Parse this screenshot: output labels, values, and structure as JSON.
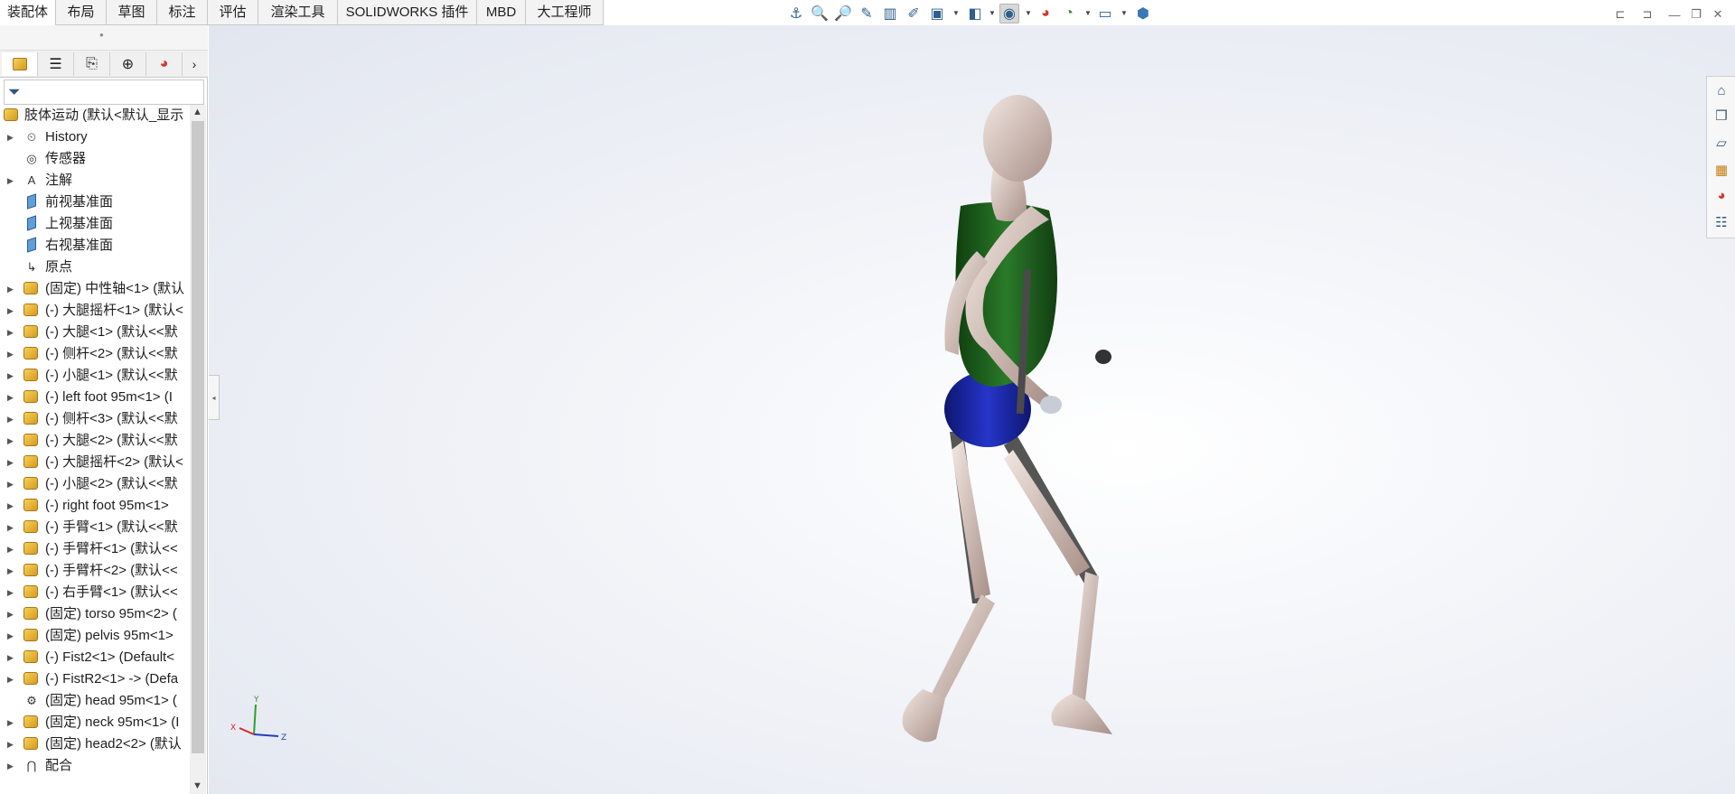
{
  "top_tabs": [
    {
      "label": "装配体",
      "active": true
    },
    {
      "label": "布局",
      "active": false
    },
    {
      "label": "草图",
      "active": false
    },
    {
      "label": "标注",
      "active": false
    },
    {
      "label": "评估",
      "active": false
    },
    {
      "label": "渲染工具",
      "active": false
    },
    {
      "label": "SOLIDWORKS 插件",
      "active": false
    },
    {
      "label": "MBD",
      "active": false
    },
    {
      "label": "大工程师",
      "active": false
    }
  ],
  "heads_up_toolbar": {
    "icons": [
      "view-orientation-icon",
      "zoom-to-fit-icon",
      "zoom-to-area-icon",
      "previous-view-icon",
      "section-view-icon",
      "dynamic-annotation-icon",
      "view-orientation-cube-icon",
      "display-style-icon",
      "hide-show-items-icon",
      "edit-appearance-icon",
      "apply-scene-icon",
      "view-settings-icon",
      "display-pane-icon"
    ]
  },
  "panel_tabs": [
    "featuremanager-icon",
    "propertymanager-icon",
    "configurationmanager-icon",
    "dimxpert-icon",
    "displaymanager-icon"
  ],
  "tree": {
    "root": "肢体运动 (默认<默认_显示",
    "items": [
      {
        "label": "History",
        "icon": "history-icon",
        "expander": true
      },
      {
        "label": "传感器",
        "icon": "sensor-icon",
        "expander": false
      },
      {
        "label": "注解",
        "icon": "annotation-icon",
        "expander": true
      },
      {
        "label": "前视基准面",
        "icon": "plane-icon",
        "expander": false
      },
      {
        "label": "上视基准面",
        "icon": "plane-icon",
        "expander": false
      },
      {
        "label": "右视基准面",
        "icon": "plane-icon",
        "expander": false
      },
      {
        "label": "原点",
        "icon": "origin-icon",
        "expander": false
      },
      {
        "label": "(固定) 中性轴<1> (默认",
        "icon": "part-icon",
        "expander": true
      },
      {
        "label": "(-) 大腿摇杆<1> (默认<",
        "icon": "part-icon",
        "expander": true
      },
      {
        "label": "(-) 大腿<1> (默认<<默",
        "icon": "part-icon",
        "expander": true
      },
      {
        "label": "(-) 侧杆<2> (默认<<默",
        "icon": "part-icon",
        "expander": true
      },
      {
        "label": "(-) 小腿<1> (默认<<默",
        "icon": "part-icon",
        "expander": true
      },
      {
        "label": "(-) left foot 95m<1> (I",
        "icon": "part-icon",
        "expander": true
      },
      {
        "label": "(-) 侧杆<3> (默认<<默",
        "icon": "part-icon",
        "expander": true
      },
      {
        "label": "(-) 大腿<2> (默认<<默",
        "icon": "part-icon",
        "expander": true
      },
      {
        "label": "(-) 大腿摇杆<2> (默认<",
        "icon": "part-icon",
        "expander": true
      },
      {
        "label": "(-) 小腿<2> (默认<<默",
        "icon": "part-icon",
        "expander": true
      },
      {
        "label": "(-) right foot 95m<1> ",
        "icon": "part-icon",
        "expander": true
      },
      {
        "label": "(-) 手臂<1> (默认<<默",
        "icon": "part-icon",
        "expander": true
      },
      {
        "label": "(-) 手臂杆<1> (默认<<",
        "icon": "part-icon",
        "expander": true
      },
      {
        "label": "(-) 手臂杆<2> (默认<<",
        "icon": "part-icon",
        "expander": true
      },
      {
        "label": "(-) 右手臂<1> (默认<<",
        "icon": "part-icon",
        "expander": true
      },
      {
        "label": "(固定) torso 95m<2> (",
        "icon": "part-icon",
        "expander": true
      },
      {
        "label": "(固定) pelvis 95m<1>",
        "icon": "part-icon",
        "expander": true
      },
      {
        "label": "(-) Fist2<1> (Default<",
        "icon": "part-icon",
        "expander": true
      },
      {
        "label": "(-) FistR2<1> -> (Defa",
        "icon": "part-icon",
        "expander": true
      },
      {
        "label": "(固定) head 95m<1> (",
        "icon": "part-outline-icon",
        "expander": false
      },
      {
        "label": "(固定) neck 95m<1> (I",
        "icon": "part-icon",
        "expander": true
      },
      {
        "label": "(固定) head2<2> (默认",
        "icon": "part-icon",
        "expander": true
      },
      {
        "label": "配合",
        "icon": "mates-icon",
        "expander": true
      }
    ]
  },
  "triad": {
    "x": "X",
    "y": "Y",
    "z": "Z"
  },
  "task_pane_icons": [
    "solidworks-resources-icon",
    "design-library-icon",
    "file-explorer-icon",
    "view-palette-icon",
    "appearances-scenes-icon",
    "custom-properties-icon"
  ],
  "colors": {
    "torso": "#1f5e1f",
    "pelvis": "#1e2aa6",
    "body": "#d8c4bb",
    "rods": "#5b5b5b"
  }
}
